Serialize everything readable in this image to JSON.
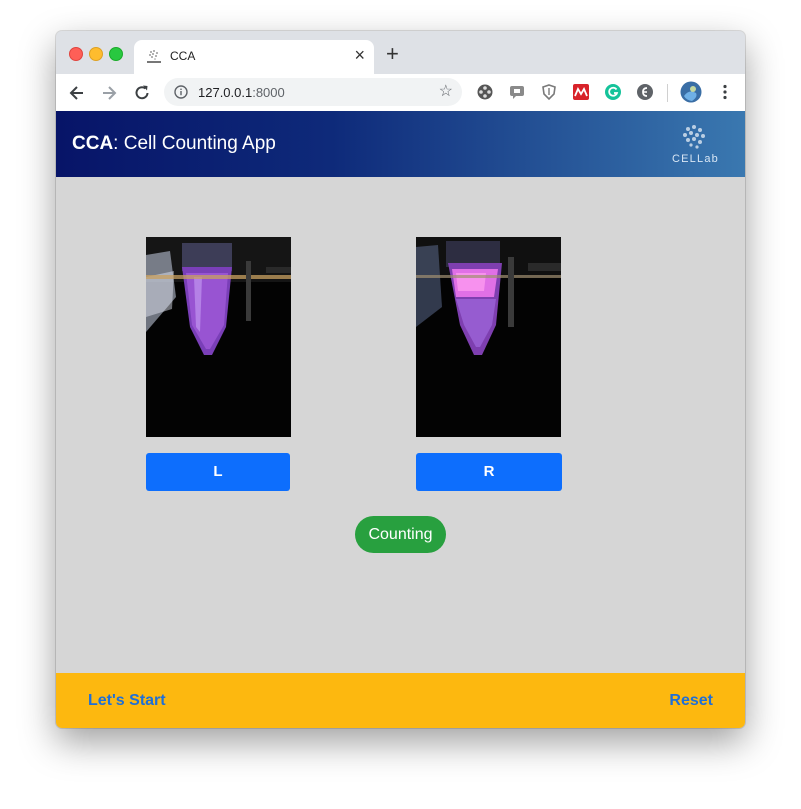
{
  "browser": {
    "tab_title": "CCA",
    "tab_close_glyph": "×",
    "new_tab_glyph": "+",
    "url_host": "127.0.0.1",
    "url_port": ":8000",
    "star_glyph": "☆",
    "extension_icons": [
      "film-reel-icon",
      "chat-bubble-icon",
      "shield-icon",
      "mendeley-icon",
      "grammarly-icon",
      "evernote-icon",
      "profile-avatar-icon"
    ]
  },
  "app": {
    "title_bold": "CCA",
    "title_rest": ": Cell Counting App",
    "lab_logo_text": "CELLab"
  },
  "samples": {
    "left_label": "L",
    "right_label": "R"
  },
  "status_button": {
    "label": "Counting",
    "color": "#28a03f"
  },
  "footer": {
    "start_label": "Let's Start",
    "reset_label": "Reset"
  },
  "colors": {
    "header_start": "#071468",
    "header_end": "#3a78b0",
    "primary_button": "#0d6efd",
    "footer_bg": "#fdb80f",
    "footer_link": "#1f6fd6",
    "content_bg": "#d6d6d6"
  }
}
